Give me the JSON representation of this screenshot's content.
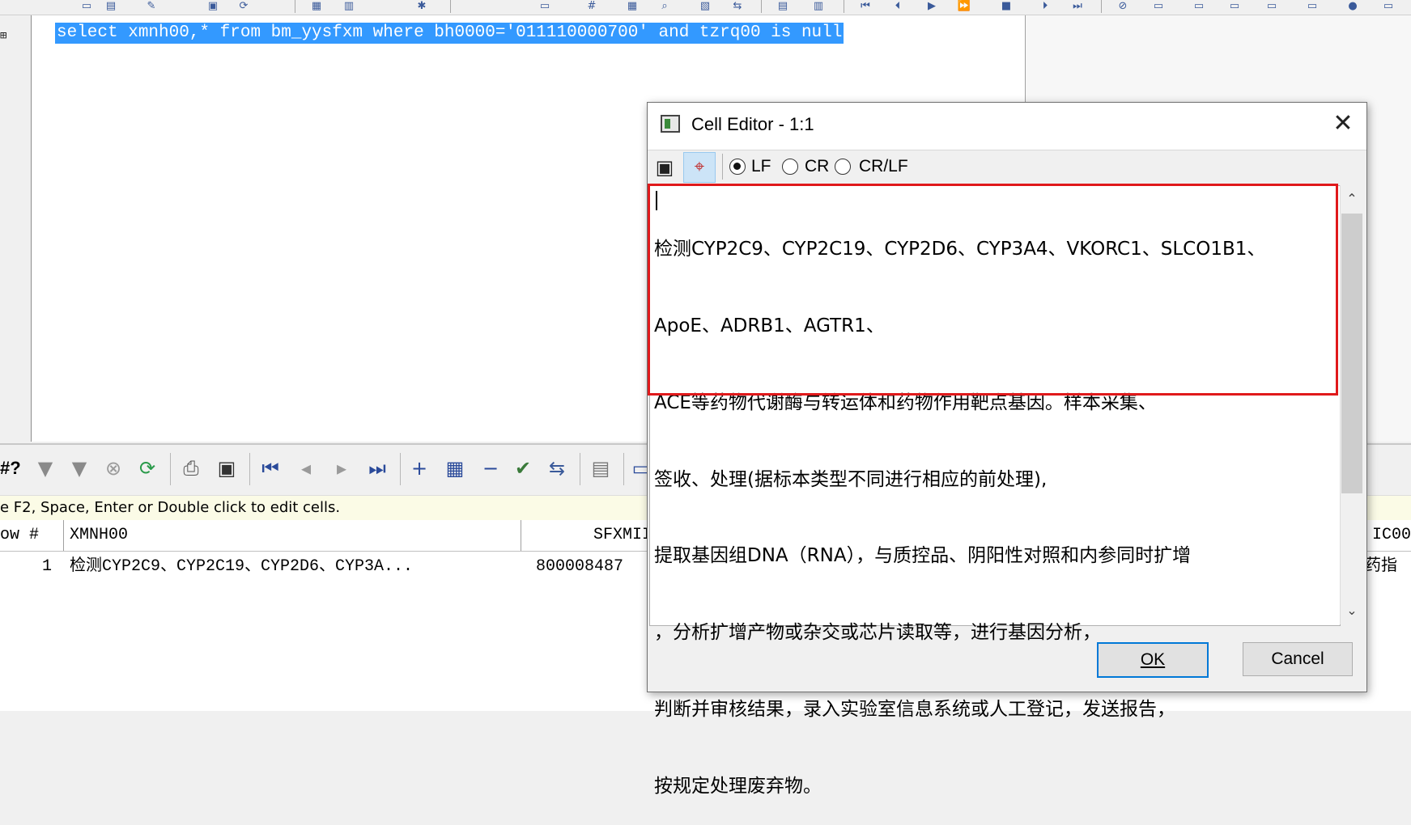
{
  "editor": {
    "sql": "select xmnh00,* from bm_yysfxm where bh0000='011110000700' and tzrq00 is null",
    "gutter_mark": "⊞"
  },
  "grid": {
    "hint": "e F2, Space, Enter or Double click to edit cells.",
    "columns": [
      "ow #",
      "XMNH00",
      "SFXMII",
      "IC00"
    ],
    "row": {
      "num": "1",
      "xmnh00": "检测CYP2C9、CYP2C19、CYP2D6、CYP3A...",
      "sfxm": "800008487",
      "ic00": "药指"
    },
    "toolbar_label": "#?"
  },
  "dialog": {
    "title": "Cell Editor - 1:1",
    "close": "✕",
    "lf_label": "LF",
    "cr_label": "CR",
    "crlf_label": "CR/LF",
    "line_ending": "LF",
    "lines": [
      "检测CYP2C9、CYP2C19、CYP2D6、CYP3A4、VKORC1、SLCO1B1、",
      "ApoE、ADRB1、AGTR1、",
      "ACE等药物代谢酶与转运体和药物作用靶点基因。样本采集、",
      "签收、处理(据标本类型不同进行相应的前处理),",
      "提取基因组DNA（RNA），与质控品、阴阳性对照和内参同时扩增",
      "，分析扩增产物或杂交或芯片读取等，进行基因分析，",
      "判断并审核结果，录入实验室信息系统或人工登记，发送报告，",
      "按规定处理废弃物。"
    ],
    "ok": "OK",
    "cancel": "Cancel"
  },
  "colors": {
    "selection": "#3399ff",
    "highlight_box": "#e0191b",
    "default_button_border": "#0078d7"
  }
}
